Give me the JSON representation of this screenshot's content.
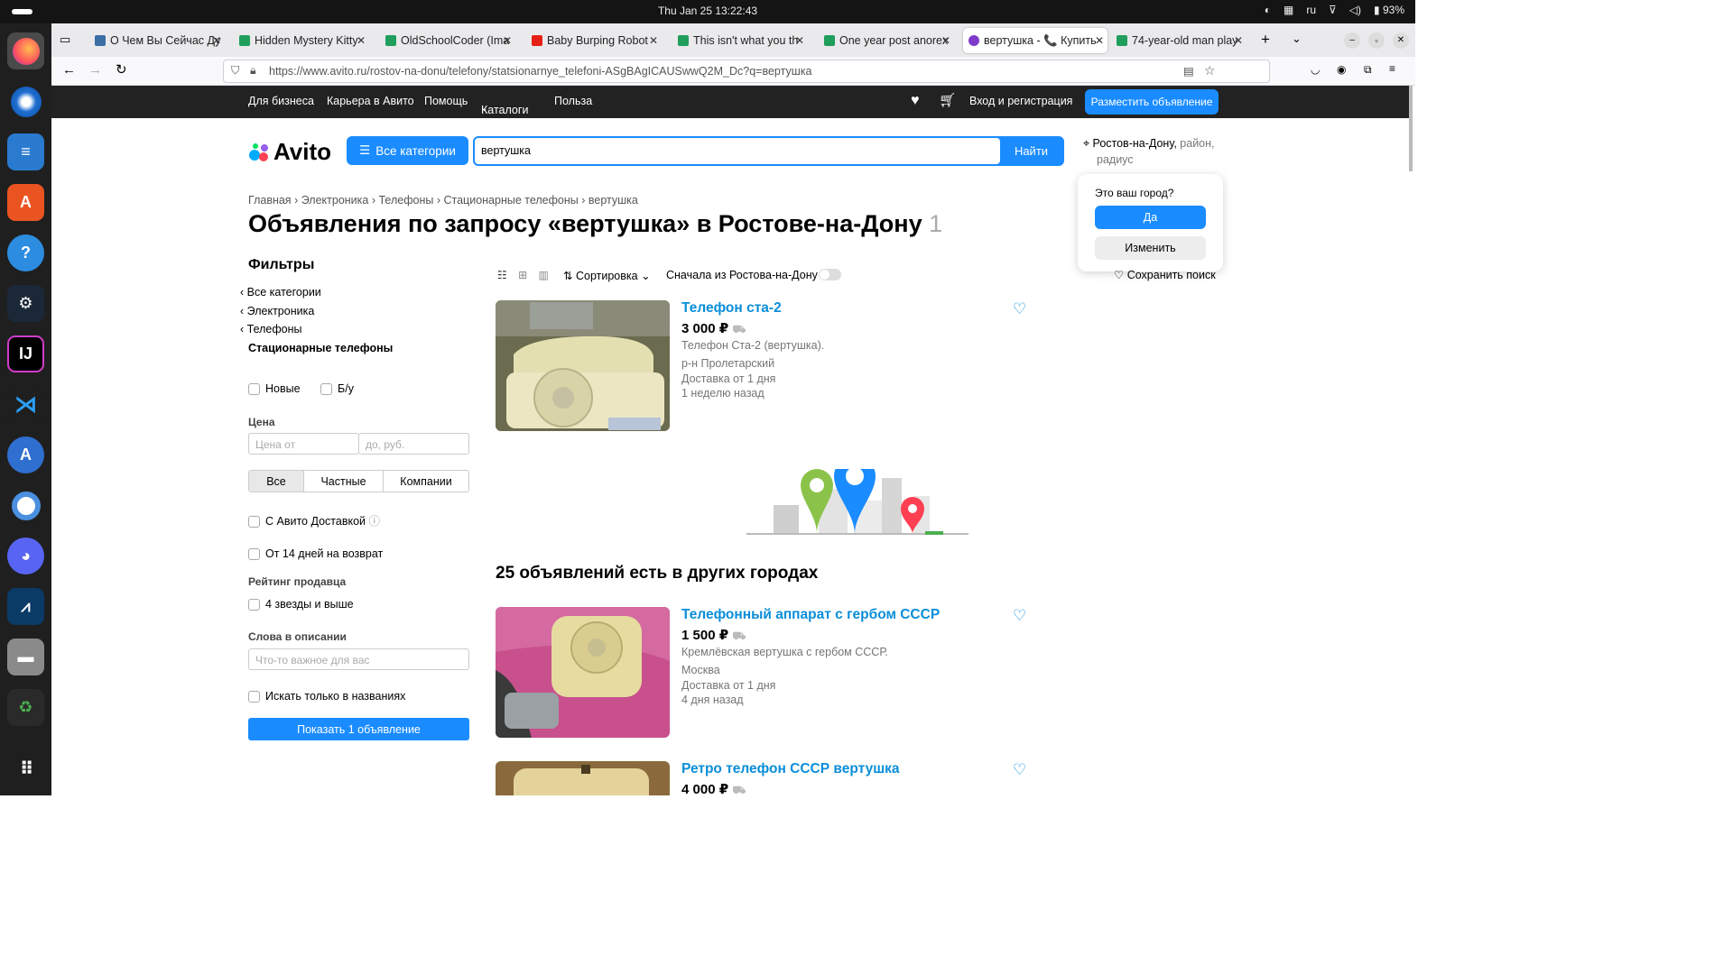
{
  "os": {
    "clock": "Thu Jan 25  13:22:43",
    "lang": "ru",
    "battery": "93%"
  },
  "tabs": [
    {
      "label": "О Чем Вы Сейчас Ду",
      "color": "#3a6ea5"
    },
    {
      "label": "Hidden Mystery Kitty",
      "color": "#1f9e5c"
    },
    {
      "label": "OldSchoolCoder (Ima",
      "color": "#1f9e5c"
    },
    {
      "label": "Baby Burping Robot",
      "color": "#e62117"
    },
    {
      "label": "This isn't what you th",
      "color": "#1f9e5c"
    },
    {
      "label": "One year post anorex",
      "color": "#1f9e5c"
    },
    {
      "label": "вертушка - 📞 Купить",
      "color": "#7f3bc9"
    },
    {
      "label": "74-year-old man play",
      "color": "#1f9e5c"
    }
  ],
  "url": "https://www.avito.ru/rostov-na-donu/telefony/statsionarnye_telefoni-ASgBAgICAUSwwQ2M_Dc?q=вертушка",
  "sitebar": {
    "business": "Для бизнеса",
    "career": "Карьера в Авито",
    "help": "Помощь",
    "catalogs": "Каталоги",
    "benefit": "Польза",
    "login": "Вход и регистрация",
    "post": "Разместить объявление"
  },
  "header": {
    "logo": "Avito",
    "all_cats": "Все категории",
    "query": "вертушка",
    "find": "Найти",
    "city": "Ростов-на-Дону,",
    "district": "район,",
    "radius": "радиус"
  },
  "popup": {
    "question": "Это ваш город?",
    "yes": "Да",
    "change": "Изменить"
  },
  "breadcrumbs": [
    "Главная",
    "Электроника",
    "Телефоны",
    "Стационарные телефоны",
    "вертушка"
  ],
  "title": "Объявления по запросу «вертушка» в Ростове-на-Дону",
  "count": "1",
  "filters": {
    "heading": "Фильтры",
    "cats": [
      "Все категории",
      "Электроника",
      "Телефоны"
    ],
    "current": "Стационарные телефоны",
    "new": "Новые",
    "used": "Б/у",
    "price": "Цена",
    "price_from": "Цена от",
    "price_to": "до, руб.",
    "seg": [
      "Все",
      "Частные",
      "Компании"
    ],
    "delivery": "С Авито Доставкой",
    "return": "От 14 дней на возврат",
    "rating": "Рейтинг продавца",
    "stars": "4 звезды и выше",
    "words": "Слова в описании",
    "words_ph": "Что-то важное для вас",
    "titles_only": "Искать только в названиях",
    "show": "Показать 1 объявление"
  },
  "toolbar": {
    "sort": "Сортировка",
    "first_local": "Сначала из Ростова-на-Дону",
    "save": "Сохранить поиск"
  },
  "listings": [
    {
      "title": "Телефон ста-2",
      "price": "3 000 ₽",
      "desc": "Телефон Ста-2 (вертушка).",
      "loc": "р-н Пролетарский",
      "delivery": "Доставка от 1 дня",
      "age": "1 неделю назад"
    },
    {
      "title": "Телефонный аппарат с гербом СССР",
      "price": "1 500 ₽",
      "desc": "Кремлёвская вертушка с гербом СССР.",
      "loc": "Москва",
      "delivery": "Доставка от 1 дня",
      "age": "4 дня назад"
    },
    {
      "title": "Ретро телефон СССР вертушка",
      "price": "4 000 ₽"
    }
  ],
  "other_cities": "25 объявлений есть в других городах"
}
